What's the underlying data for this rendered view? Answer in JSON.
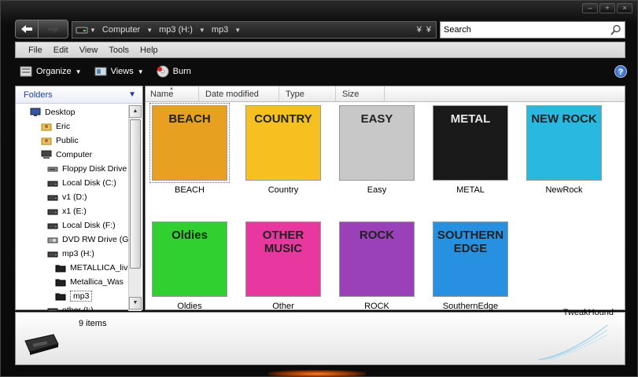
{
  "window": {
    "caption_buttons": [
      "–",
      "+",
      "×"
    ]
  },
  "address": {
    "crumbs": [
      "Computer",
      "mp3 (H:)",
      "mp3"
    ]
  },
  "search": {
    "placeholder": "Search"
  },
  "menu": {
    "items": [
      "File",
      "Edit",
      "View",
      "Tools",
      "Help"
    ]
  },
  "toolbar": {
    "organize": "Organize",
    "views": "Views",
    "burn": "Burn",
    "help": "?"
  },
  "sidebar": {
    "header": "Folders",
    "items": [
      {
        "label": "Desktop",
        "icon": "desktop-icon",
        "level": 0
      },
      {
        "label": "Eric",
        "icon": "user-folder-icon",
        "level": 1
      },
      {
        "label": "Public",
        "icon": "user-folder-icon",
        "level": 1
      },
      {
        "label": "Computer",
        "icon": "computer-icon",
        "level": 1
      },
      {
        "label": "Floppy Disk Drive",
        "icon": "floppy-drive-icon",
        "level": 2
      },
      {
        "label": "Local Disk (C:)",
        "icon": "hard-disk-icon",
        "level": 2
      },
      {
        "label": "v1 (D:)",
        "icon": "hard-disk-icon",
        "level": 2
      },
      {
        "label": "x1 (E:)",
        "icon": "hard-disk-icon",
        "level": 2
      },
      {
        "label": "Local Disk (F:)",
        "icon": "hard-disk-icon",
        "level": 2
      },
      {
        "label": "DVD RW Drive (G:)",
        "icon": "dvd-drive-icon",
        "level": 2
      },
      {
        "label": "mp3 (H:)",
        "icon": "hard-disk-icon",
        "level": 2
      },
      {
        "label": "METALLICA_live",
        "icon": "folder-icon",
        "level": 3
      },
      {
        "label": "Metallica_Was",
        "icon": "folder-icon",
        "level": 3
      },
      {
        "label": "mp3",
        "icon": "folder-icon",
        "level": 3,
        "selected": true
      },
      {
        "label": "other (I:)",
        "icon": "hard-disk-icon",
        "level": 2
      }
    ]
  },
  "columns": [
    "Name",
    "Date modified",
    "Type",
    "Size"
  ],
  "files": [
    {
      "name": "BEACH",
      "art": "BEACH",
      "bg": "#e8a020"
    },
    {
      "name": "Country",
      "art": "COUNTRY",
      "bg": "#f5c020"
    },
    {
      "name": "Easy",
      "art": "EASY",
      "bg": "#c8c8c8"
    },
    {
      "name": "METAL",
      "art": "METAL",
      "bg": "#1a1a1a"
    },
    {
      "name": "NewRock",
      "art": "NEW ROCK",
      "bg": "#28b8e0"
    },
    {
      "name": "Oldies",
      "art": "Oldies",
      "bg": "#30d030"
    },
    {
      "name": "Other",
      "art": "OTHER MUSIC",
      "bg": "#e838a0"
    },
    {
      "name": "ROCK",
      "art": "ROCK",
      "bg": "#9a40b8"
    },
    {
      "name": "SouthernEdge",
      "art": "SOUTHERN EDGE",
      "bg": "#2890e0"
    }
  ],
  "status": {
    "count": "9 items",
    "watermark": "TweakHound"
  },
  "colors": {
    "folders_header": "#1c3f94",
    "help_blue": "#1a4aa8",
    "glow": "#ff7a20"
  }
}
